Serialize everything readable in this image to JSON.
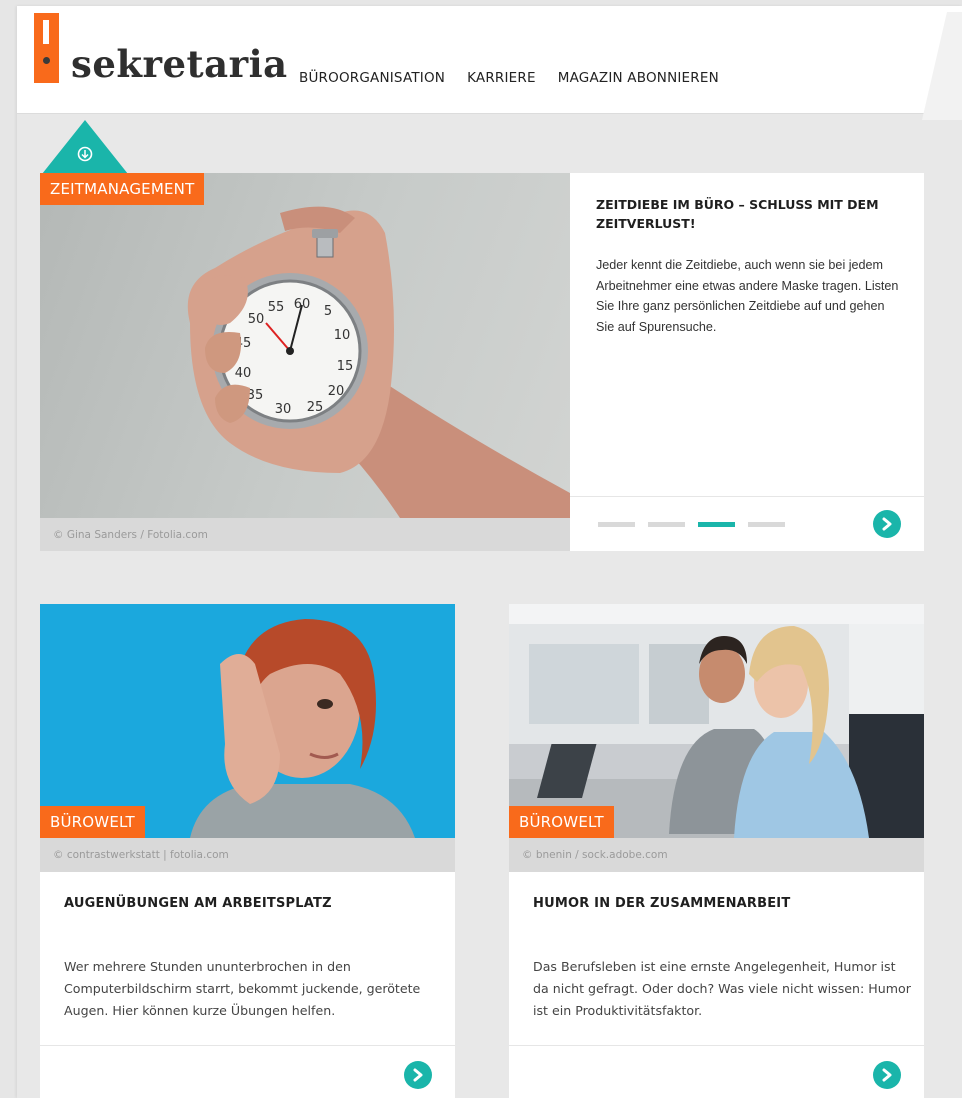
{
  "brand": {
    "name": "sekretaria",
    "orange": "#f96a1b",
    "teal": "#1ab5aa"
  },
  "nav": {
    "items": [
      "BÜROORGANISATION",
      "KARRIERE",
      "MAGAZIN ABONNIEREN"
    ]
  },
  "hero": {
    "tag": "ZEITMANAGEMENT",
    "credit": "© Gina Sanders / Fotolia.com",
    "title": "ZEITDIEBE IM BÜRO – SCHLUSS MIT DEM ZEITVERLUST!",
    "body": "Jeder kennt die Zeitdiebe, auch wenn sie bei jedem Arbeitnehmer eine etwas andere Maske tragen. Listen Sie Ihre ganz persönlichen Zeitdiebe auf und gehen Sie auf Spurensuche.",
    "slide_count": 4,
    "active_slide": 3,
    "next_icon": "chevron-right-circle-icon",
    "badge_icon": "download-icon"
  },
  "cards": [
    {
      "tag": "BÜROWELT",
      "credit": "© contrastwerkstatt | fotolia.com",
      "title": "AUGENÜBUNGEN AM ARBEITSPLATZ",
      "body": "Wer mehrere Stunden ununterbrochen in den Computerbildschirm starrt, bekommt juckende, gerötete Augen. Hier können kurze Übungen helfen.",
      "next_icon": "chevron-right-circle-icon"
    },
    {
      "tag": "BÜROWELT",
      "credit": "© bnenin / sock.adobe.com",
      "title": "HUMOR IN DER ZUSAMMENARBEIT",
      "body": "Das Berufsleben ist eine ernste Angelegenheit, Humor ist da nicht gefragt. Oder doch? Was viele nicht wissen: Humor ist ein Produktivitätsfaktor.",
      "next_icon": "chevron-right-circle-icon"
    }
  ]
}
